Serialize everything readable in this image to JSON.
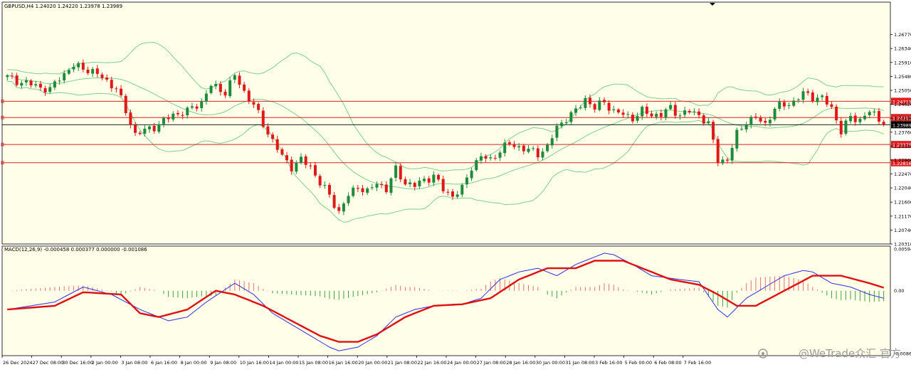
{
  "header": {
    "symbol_info": "GBPUSD,H4  1.24020 1.24220 1.23978 1.23989",
    "macd_info": "MACD(12,26,9) -0.000458 0.000377 0.000000 -0.001086"
  },
  "watermark": {
    "text": "@WeTrade众汇 官方"
  },
  "colors": {
    "background": "#fefee9",
    "bull": "#1e8a3c",
    "bear": "#e01818",
    "bands": "#7fcf8f",
    "levels": "#e02020",
    "current_price_line": "#000000",
    "macd_line": "#3030e0",
    "signal_line": "#e01010",
    "hist_pos": "#e07070",
    "hist_neg": "#40a040"
  },
  "chart_data": [
    {
      "type": "candlestick",
      "title": "GBPUSD,H4",
      "ylim": [
        1.2031,
        1.2777
      ],
      "y_ticks": [
        "1.26770",
        "1.26340",
        "1.25910",
        "1.25480",
        "1.25050",
        "1.24620",
        "1.24190",
        "1.23760",
        "1.23330",
        "1.22900",
        "1.22470",
        "1.22040",
        "1.21600",
        "1.21170",
        "1.20740",
        "1.20310"
      ],
      "x_ticks": [
        "26 Dec 2024",
        "27 Dec 08:00",
        "30 Dec 16:00",
        "2 Jan 00:00",
        "3 Jan 08:00",
        "6 Jan 16:00",
        "8 Jan 00:00",
        "9 Jan 08:00",
        "10 Jan 16:00",
        "14 Jan 00:00",
        "15 Jan 08:00",
        "16 Jan 16:00",
        "20 Jan 00:00",
        "21 Jan 08:00",
        "22 Jan 16:00",
        "24 Jan 00:00",
        "27 Jan 08:00",
        "28 Jan 16:00",
        "30 Jan 00:00",
        "31 Jan 08:00",
        "3 Feb 16:00",
        "5 Feb 00:00",
        "6 Feb 08:00",
        "7 Feb 16:00"
      ],
      "horizontal_levels": [
        {
          "label": "1.24711",
          "value": 1.24711
        },
        {
          "label": "1.24210",
          "value": 1.2421
        },
        {
          "label": "1.23379",
          "value": 1.23379
        },
        {
          "label": "1.22816",
          "value": 1.22816
        }
      ],
      "current_price": {
        "label": "1.23989",
        "value": 1.23989
      },
      "close_anchors": [
        [
          0,
          1.2545
        ],
        [
          3,
          1.253
        ],
        [
          6,
          1.252
        ],
        [
          9,
          1.2505
        ],
        [
          11,
          1.2545
        ],
        [
          14,
          1.258
        ],
        [
          17,
          1.257
        ],
        [
          20,
          1.2545
        ],
        [
          23,
          1.251
        ],
        [
          25,
          1.244
        ],
        [
          27,
          1.237
        ],
        [
          29,
          1.238
        ],
        [
          32,
          1.24
        ],
        [
          35,
          1.243
        ],
        [
          38,
          1.244
        ],
        [
          41,
          1.247
        ],
        [
          43,
          1.252
        ],
        [
          46,
          1.25
        ],
        [
          48,
          1.255
        ],
        [
          50,
          1.25
        ],
        [
          52,
          1.246
        ],
        [
          54,
          1.24
        ],
        [
          56,
          1.235
        ],
        [
          58,
          1.23
        ],
        [
          60,
          1.227
        ],
        [
          62,
          1.229
        ],
        [
          64,
          1.227
        ],
        [
          66,
          1.222
        ],
        [
          68,
          1.218
        ],
        [
          70,
          1.213
        ],
        [
          72,
          1.218
        ],
        [
          74,
          1.221
        ],
        [
          76,
          1.219
        ],
        [
          78,
          1.222
        ],
        [
          80,
          1.22
        ],
        [
          82,
          1.226
        ],
        [
          84,
          1.222
        ],
        [
          86,
          1.221
        ],
        [
          88,
          1.223
        ],
        [
          90,
          1.224
        ],
        [
          92,
          1.22
        ],
        [
          94,
          1.218
        ],
        [
          96,
          1.22
        ],
        [
          98,
          1.227
        ],
        [
          100,
          1.23
        ],
        [
          102,
          1.229
        ],
        [
          104,
          1.232
        ],
        [
          106,
          1.234
        ],
        [
          108,
          1.233
        ],
        [
          110,
          1.232
        ],
        [
          112,
          1.231
        ],
        [
          114,
          1.233
        ],
        [
          116,
          1.239
        ],
        [
          118,
          1.242
        ],
        [
          120,
          1.244
        ],
        [
          122,
          1.248
        ],
        [
          124,
          1.245
        ],
        [
          126,
          1.247
        ],
        [
          128,
          1.244
        ],
        [
          130,
          1.243
        ],
        [
          132,
          1.242
        ],
        [
          134,
          1.244
        ],
        [
          136,
          1.243
        ],
        [
          138,
          1.243
        ],
        [
          140,
          1.245
        ],
        [
          142,
          1.243
        ],
        [
          144,
          1.244
        ],
        [
          146,
          1.243
        ],
        [
          148,
          1.24
        ],
        [
          150,
          1.229
        ],
        [
          152,
          1.229
        ],
        [
          154,
          1.237
        ],
        [
          156,
          1.241
        ],
        [
          158,
          1.242
        ],
        [
          160,
          1.24
        ],
        [
          162,
          1.245
        ],
        [
          164,
          1.246
        ],
        [
          166,
          1.247
        ],
        [
          168,
          1.2495
        ],
        [
          170,
          1.2485
        ],
        [
          172,
          1.248
        ],
        [
          174,
          1.245
        ],
        [
          176,
          1.238
        ],
        [
          178,
          1.242
        ],
        [
          180,
          1.2415
        ],
        [
          182,
          1.244
        ],
        [
          184,
          1.2415
        ],
        [
          185,
          1.2399
        ]
      ],
      "macd_panel": {
        "ylim": [
          -0.00864,
          0.00594
        ],
        "y_ticks": [
          "0.00594",
          "0.00",
          "-0.00864"
        ],
        "macd_line": [
          [
            0,
            -0.0025
          ],
          [
            10,
            -0.0015
          ],
          [
            16,
            0.0005
          ],
          [
            22,
            -0.0005
          ],
          [
            28,
            -0.0025
          ],
          [
            34,
            -0.004
          ],
          [
            38,
            -0.0035
          ],
          [
            42,
            -0.0015
          ],
          [
            48,
            0.001
          ],
          [
            52,
            -0.0005
          ],
          [
            56,
            -0.003
          ],
          [
            60,
            -0.0045
          ],
          [
            64,
            -0.006
          ],
          [
            68,
            -0.0075
          ],
          [
            70,
            -0.008
          ],
          [
            74,
            -0.0075
          ],
          [
            78,
            -0.006
          ],
          [
            82,
            -0.0035
          ],
          [
            86,
            -0.0025
          ],
          [
            90,
            -0.002
          ],
          [
            94,
            -0.0018
          ],
          [
            96,
            -0.0018
          ],
          [
            100,
            -0.001
          ],
          [
            104,
            0.0015
          ],
          [
            108,
            0.0025
          ],
          [
            112,
            0.003
          ],
          [
            116,
            0.002
          ],
          [
            120,
            0.0035
          ],
          [
            124,
            0.0045
          ],
          [
            126,
            0.005
          ],
          [
            128,
            0.0048
          ],
          [
            132,
            0.0035
          ],
          [
            136,
            0.002
          ],
          [
            142,
            0.0015
          ],
          [
            146,
            0.0012
          ],
          [
            150,
            -0.0025
          ],
          [
            152,
            -0.0035
          ],
          [
            156,
            -0.001
          ],
          [
            160,
            0.0005
          ],
          [
            164,
            0.002
          ],
          [
            168,
            0.0027
          ],
          [
            170,
            0.0025
          ],
          [
            174,
            0.001
          ],
          [
            178,
            0.0005
          ],
          [
            182,
            -0.0005
          ],
          [
            185,
            -0.001
          ]
        ],
        "signal_line": [
          [
            0,
            -0.0025
          ],
          [
            10,
            -0.002
          ],
          [
            16,
            -0.0002
          ],
          [
            24,
            -0.0005
          ],
          [
            28,
            -0.003
          ],
          [
            32,
            -0.0035
          ],
          [
            38,
            -0.0025
          ],
          [
            44,
            0.0
          ],
          [
            48,
            -0.0005
          ],
          [
            54,
            -0.002
          ],
          [
            60,
            -0.004
          ],
          [
            66,
            -0.006
          ],
          [
            70,
            -0.0068
          ],
          [
            74,
            -0.0068
          ],
          [
            78,
            -0.0058
          ],
          [
            84,
            -0.0035
          ],
          [
            90,
            -0.002
          ],
          [
            96,
            -0.0018
          ],
          [
            102,
            -0.001
          ],
          [
            108,
            0.0015
          ],
          [
            114,
            0.003
          ],
          [
            120,
            0.003
          ],
          [
            124,
            0.004
          ],
          [
            130,
            0.004
          ],
          [
            134,
            0.003
          ],
          [
            140,
            0.0015
          ],
          [
            146,
            0.0008
          ],
          [
            150,
            -0.0005
          ],
          [
            154,
            -0.002
          ],
          [
            158,
            -0.002
          ],
          [
            164,
            0.0
          ],
          [
            170,
            0.002
          ],
          [
            176,
            0.002
          ],
          [
            182,
            0.001
          ],
          [
            185,
            0.0004
          ]
        ]
      }
    }
  ]
}
